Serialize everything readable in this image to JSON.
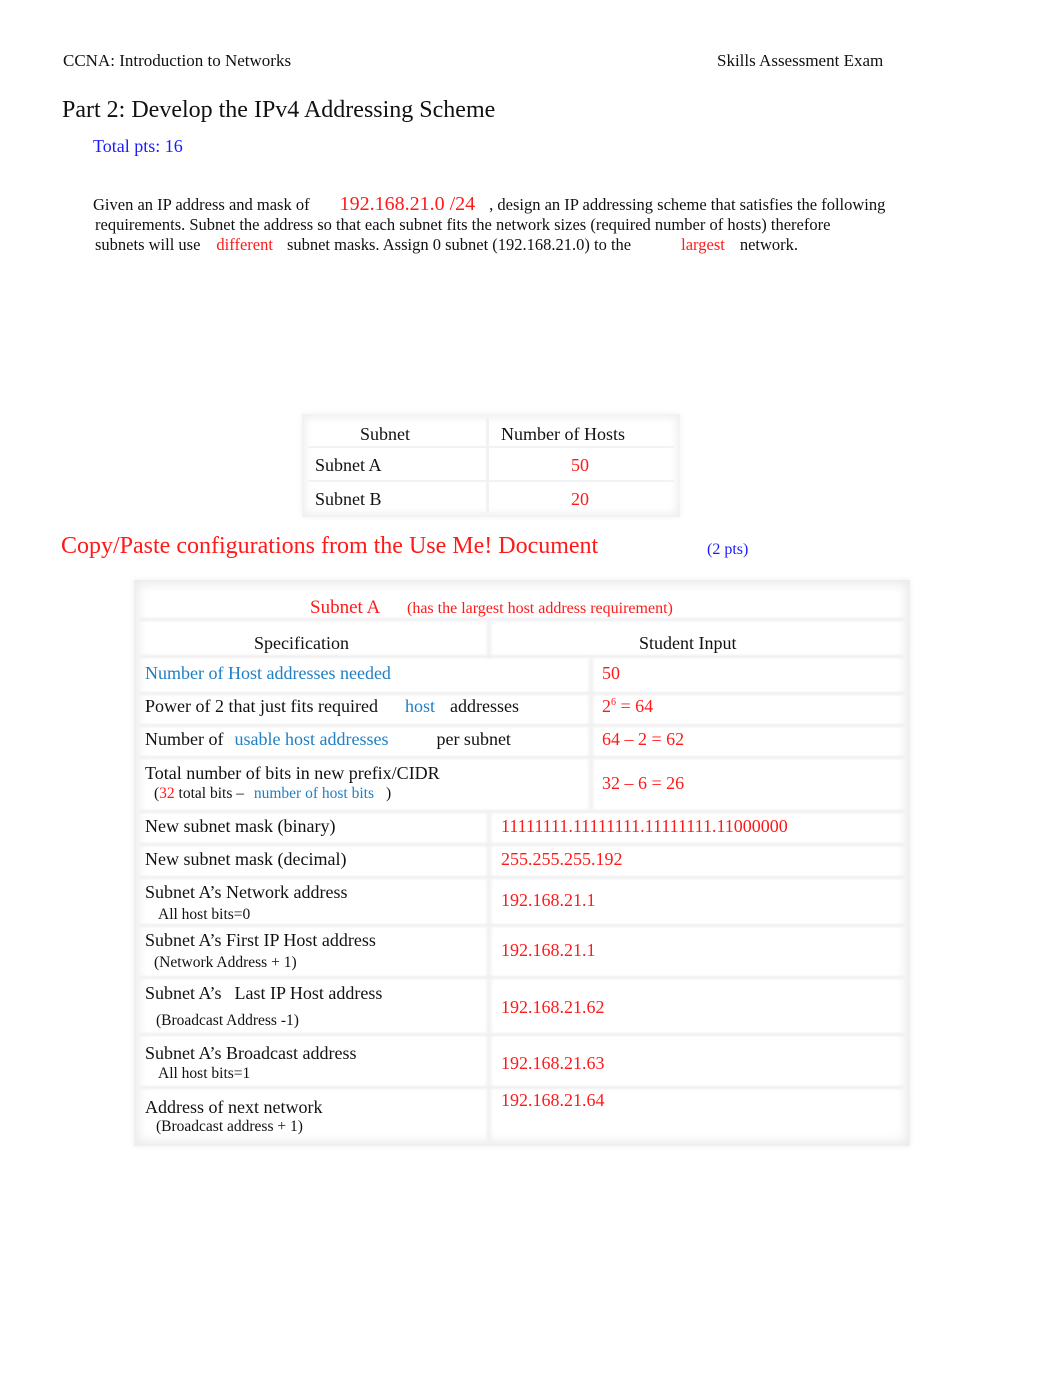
{
  "header": {
    "course": "CCNA: Introduction to Networks",
    "exam": "Skills Assessment Exam"
  },
  "part": {
    "title": "Part 2: Develop the IPv4 Addressing Scheme",
    "total_points": "Total pts: 16"
  },
  "intro": {
    "text_1": "Given an IP address and mask of",
    "ip_mask": "192.168.21.0 /24",
    "text_2": ", design an IP addressing scheme that satisfies the following",
    "line_2": "requirements. Subnet the address so that each subnet fits the network sizes (required number of hosts) therefore",
    "text_3": "subnets will use",
    "mask_type": "different",
    "text_4": "subnet masks. Assign 0 subnet (192.168.21.0) to the",
    "network_choice": "largest",
    "text_5": "network."
  },
  "requirements_table": {
    "headers": [
      "Subnet",
      "Number of Hosts"
    ],
    "rows": [
      {
        "subnet": "Subnet A",
        "hosts": "50"
      },
      {
        "subnet": "Subnet B",
        "hosts": "20"
      }
    ]
  },
  "copy_section": {
    "title": "Copy/Paste configurations from the Use Me! Document",
    "points": "(2 pts)"
  },
  "subnet_a_table": {
    "title": "Subnet A",
    "title_note": "(has the largest host address requirement)",
    "headers": [
      "Specification",
      "Student Input"
    ],
    "rows": [
      {
        "spec": "Number of Host addresses needed",
        "input": "50"
      },
      {
        "spec_1": "Power of 2 that just fits required",
        "spec_hl": "host",
        "spec_2": "addresses",
        "input_base": "2",
        "input_exp": "6",
        "input_rest": " = 64"
      },
      {
        "spec_1": "Number of",
        "spec_hl": "usable host addresses",
        "spec_2": "per subnet",
        "input": "64 – 2 = 62"
      },
      {
        "spec": "Total number of bits in new prefix/CIDR",
        "sub_open": "(",
        "sub_num": "32",
        "sub_mid": "total bits –",
        "sub_hl": "number of host bits",
        "sub_close": ")",
        "input": "32 – 6 = 26"
      },
      {
        "spec": "New subnet mask (binary)",
        "input": "11111111.11111111.11111111.11000000"
      },
      {
        "spec": "New subnet mask (decimal)",
        "input": "255.255.255.192"
      },
      {
        "spec": "Subnet A’s Network address",
        "sub": "All host bits=0",
        "input": "192.168.21.1"
      },
      {
        "spec": "Subnet A’s First IP Host address",
        "sub": "(Network Address + 1)",
        "input": "192.168.21.1"
      },
      {
        "spec_1": "Subnet A’s",
        "spec_2": "Last IP Host address",
        "sub": "(Broadcast Address -1)",
        "input": "192.168.21.62"
      },
      {
        "spec": "Subnet A’s Broadcast address",
        "sub": "All host bits=1",
        "input": "192.168.21.63"
      },
      {
        "spec": "Address of next network",
        "sub": "(Broadcast address + 1)",
        "input": "192.168.21.64"
      }
    ]
  }
}
